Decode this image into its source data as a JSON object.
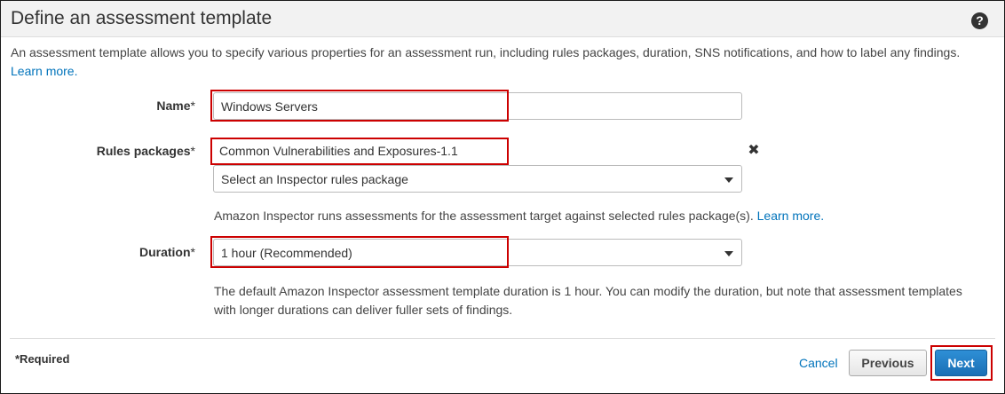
{
  "header": {
    "title": "Define an assessment template",
    "help_icon": "help-icon"
  },
  "intro": {
    "text": "An assessment template allows you to specify various properties for an assessment run, including rules packages, duration, SNS notifications, and how to label any findings.",
    "learn_more": "Learn more."
  },
  "form": {
    "name": {
      "label": "Name",
      "required_mark": "*",
      "value": "Windows Servers"
    },
    "rules_packages": {
      "label": "Rules packages",
      "required_mark": "*",
      "selected": "Common Vulnerabilities and Exposures-1.1",
      "remove_icon": "✖",
      "select_placeholder": "Select an Inspector rules package",
      "hint": "Amazon Inspector runs assessments for the assessment target against selected rules package(s).",
      "hint_link": "Learn more."
    },
    "duration": {
      "label": "Duration",
      "required_mark": "*",
      "value": "1 hour (Recommended)",
      "hint_line1": "The default Amazon Inspector assessment template duration is 1 hour. You can modify the duration, but note that assessment templates",
      "hint_line2": "with longer durations can deliver fuller sets of findings."
    }
  },
  "footer": {
    "required_note": "*Required",
    "cancel_label": "Cancel",
    "previous_label": "Previous",
    "next_label": "Next"
  },
  "colors": {
    "link": "#0073bb",
    "highlight": "#cc0000",
    "primary_button": "#1a6fb5"
  }
}
